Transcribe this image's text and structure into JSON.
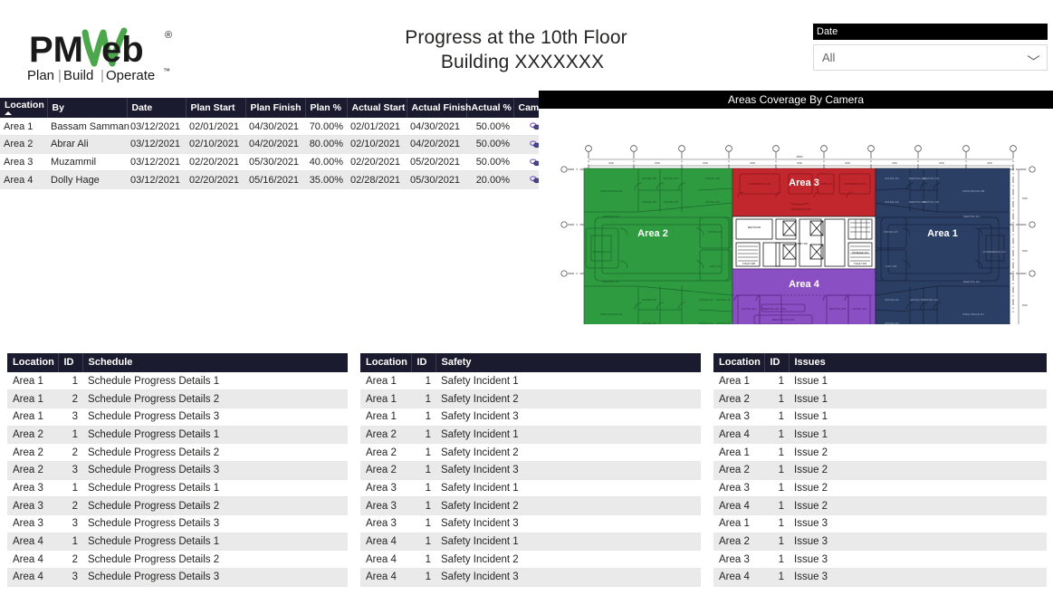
{
  "brand": {
    "logo_text": "PMWeb",
    "logo_mark_color": "#4ca64c",
    "registered_mark": "®",
    "tagline": "Plan|Build|Operate",
    "tagline_tm": "™"
  },
  "header": {
    "title_line1": "Progress at the 10th Floor",
    "title_line2": "Building XXXXXXX"
  },
  "date_slicer": {
    "label": "Date",
    "value": "All",
    "chevron_icon": "chevron-down-icon"
  },
  "progress_table": {
    "columns": [
      "Location",
      "By",
      "Date",
      "Plan Start",
      "Plan Finish",
      "Plan %",
      "Actual Start",
      "Actual Finish",
      "Actual %",
      "Camera"
    ],
    "sort_column": "Location",
    "sort_direction": "ascending",
    "camera_icon": "camera-link-icon",
    "rows": [
      {
        "location": "Area 1",
        "by": "Bassam Samman",
        "date": "03/12/2021",
        "plan_start": "02/01/2021",
        "plan_finish": "04/30/2021",
        "plan_pct": "70.00%",
        "actual_start": "02/01/2021",
        "actual_finish": "04/30/2021",
        "actual_pct": "50.00%"
      },
      {
        "location": "Area 2",
        "by": "Abrar Ali",
        "date": "03/12/2021",
        "plan_start": "02/10/2021",
        "plan_finish": "04/20/2021",
        "plan_pct": "80.00%",
        "actual_start": "02/10/2021",
        "actual_finish": "04/20/2021",
        "actual_pct": "50.00%"
      },
      {
        "location": "Area 3",
        "by": "Muzammil",
        "date": "03/12/2021",
        "plan_start": "02/20/2021",
        "plan_finish": "05/30/2021",
        "plan_pct": "40.00%",
        "actual_start": "02/20/2021",
        "actual_finish": "05/20/2021",
        "actual_pct": "50.00%"
      },
      {
        "location": "Area 4",
        "by": "Dolly Hage",
        "date": "03/12/2021",
        "plan_start": "02/20/2021",
        "plan_finish": "05/16/2021",
        "plan_pct": "35.00%",
        "actual_start": "02/28/2021",
        "actual_finish": "05/30/2021",
        "actual_pct": "20.00%"
      }
    ]
  },
  "floorplan": {
    "title": "Areas Coverage By Camera",
    "areas": [
      {
        "name": "Area 1",
        "color": "#2b3e63"
      },
      {
        "name": "Area 2",
        "color": "#2f9b41"
      },
      {
        "name": "Area 3",
        "color": "#c1272d"
      },
      {
        "name": "Area 4",
        "color": "#8b4fc4"
      }
    ]
  },
  "schedule_table": {
    "columns": [
      "Location",
      "ID",
      "Schedule"
    ],
    "rows": [
      {
        "location": "Area 1",
        "id": "1",
        "text": "Schedule Progress Details 1"
      },
      {
        "location": "Area 1",
        "id": "2",
        "text": "Schedule Progress Details 2"
      },
      {
        "location": "Area 1",
        "id": "3",
        "text": "Schedule Progress Details 3"
      },
      {
        "location": "Area 2",
        "id": "1",
        "text": "Schedule Progress Details 1"
      },
      {
        "location": "Area 2",
        "id": "2",
        "text": "Schedule Progress Details 2"
      },
      {
        "location": "Area 2",
        "id": "3",
        "text": "Schedule Progress Details 3"
      },
      {
        "location": "Area 3",
        "id": "1",
        "text": "Schedule Progress Details 1"
      },
      {
        "location": "Area 3",
        "id": "2",
        "text": "Schedule Progress Details 2"
      },
      {
        "location": "Area 3",
        "id": "3",
        "text": "Schedule Progress Details 3"
      },
      {
        "location": "Area 4",
        "id": "1",
        "text": "Schedule Progress Details 1"
      },
      {
        "location": "Area 4",
        "id": "2",
        "text": "Schedule Progress Details 2"
      },
      {
        "location": "Area 4",
        "id": "3",
        "text": "Schedule Progress Details 3"
      }
    ]
  },
  "safety_table": {
    "columns": [
      "Location",
      "ID",
      "Safety"
    ],
    "rows": [
      {
        "location": "Area 1",
        "id": "1",
        "text": "Safety Incident 1"
      },
      {
        "location": "Area 1",
        "id": "1",
        "text": "Safety Incident 2"
      },
      {
        "location": "Area 1",
        "id": "1",
        "text": "Safety Incident 3"
      },
      {
        "location": "Area 2",
        "id": "1",
        "text": "Safety Incident 1"
      },
      {
        "location": "Area 2",
        "id": "1",
        "text": "Safety Incident 2"
      },
      {
        "location": "Area 2",
        "id": "1",
        "text": "Safety Incident 3"
      },
      {
        "location": "Area 3",
        "id": "1",
        "text": "Safety Incident 1"
      },
      {
        "location": "Area 3",
        "id": "1",
        "text": "Safety Incident 2"
      },
      {
        "location": "Area 3",
        "id": "1",
        "text": "Safety Incident 3"
      },
      {
        "location": "Area 4",
        "id": "1",
        "text": "Safety Incident 1"
      },
      {
        "location": "Area 4",
        "id": "1",
        "text": "Safety Incident 2"
      },
      {
        "location": "Area 4",
        "id": "1",
        "text": "Safety Incident 3"
      }
    ]
  },
  "issues_table": {
    "columns": [
      "Location",
      "ID",
      "Issues"
    ],
    "rows": [
      {
        "location": "Area 1",
        "id": "1",
        "text": "Issue 1"
      },
      {
        "location": "Area 2",
        "id": "1",
        "text": "Issue 1"
      },
      {
        "location": "Area 3",
        "id": "1",
        "text": "Issue 1"
      },
      {
        "location": "Area 4",
        "id": "1",
        "text": "Issue 1"
      },
      {
        "location": "Area 1",
        "id": "1",
        "text": "Issue 2"
      },
      {
        "location": "Area 2",
        "id": "1",
        "text": "Issue 2"
      },
      {
        "location": "Area 3",
        "id": "1",
        "text": "Issue 2"
      },
      {
        "location": "Area 4",
        "id": "1",
        "text": "Issue 2"
      },
      {
        "location": "Area 1",
        "id": "1",
        "text": "Issue 3"
      },
      {
        "location": "Area 2",
        "id": "1",
        "text": "Issue 3"
      },
      {
        "location": "Area 3",
        "id": "1",
        "text": "Issue 3"
      },
      {
        "location": "Area 4",
        "id": "1",
        "text": "Issue 3"
      }
    ]
  }
}
